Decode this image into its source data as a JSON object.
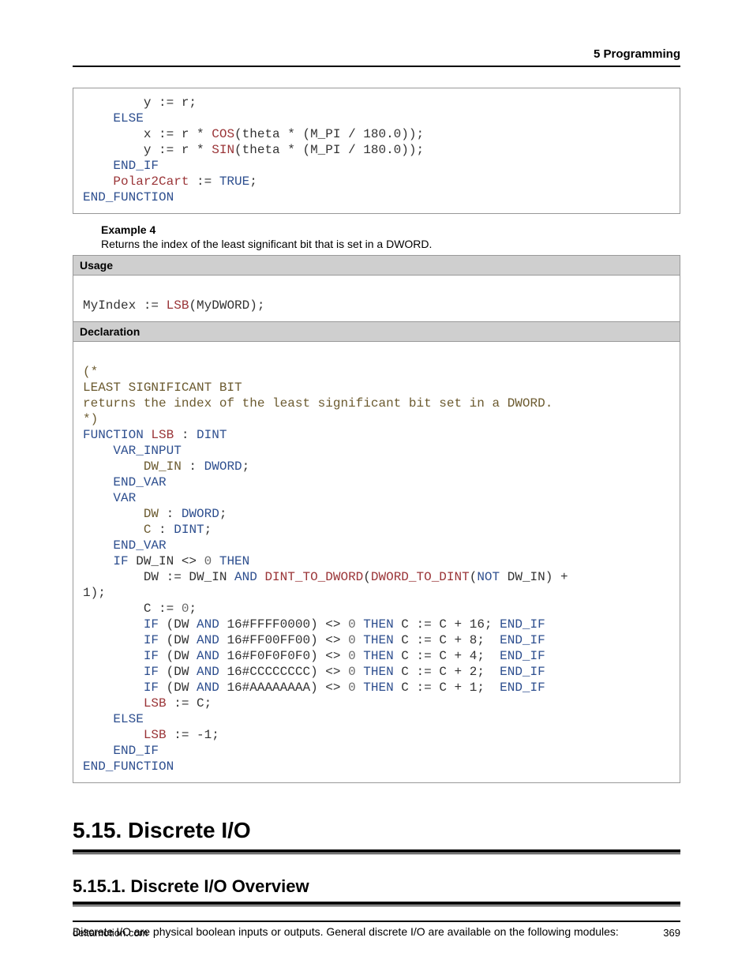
{
  "runhead": "5  Programming",
  "code1": {
    "l1a": "        y := r;",
    "l2a": "    ",
    "l2b": "ELSE",
    "l3a": "        x := r * ",
    "l3b": "COS",
    "l3c": "(theta * (M_PI / 180.0));",
    "l4a": "        y := r * ",
    "l4b": "SIN",
    "l4c": "(theta * (M_PI / 180.0));",
    "l5a": "    ",
    "l5b": "END_IF",
    "l6a": "    ",
    "l6b": "Polar2Cart",
    "l6c": " := ",
    "l6d": "TRUE",
    "l6e": ";",
    "l7": "END_FUNCTION"
  },
  "ex4": {
    "title": "Example 4",
    "desc": "Returns the index of the least significant bit that is set in a DWORD."
  },
  "usage_label": "Usage",
  "usage": {
    "a": "MyIndex := ",
    "b": "LSB",
    "c": "(MyDWORD);"
  },
  "decl_label": "Declaration",
  "code2": {
    "c1": "(*",
    "c2": "LEAST SIGNIFICANT BIT",
    "c3": "returns the index of the least significant bit set in a DWORD.",
    "c4": "*)",
    "f1a": "FUNCTION ",
    "f1b": "LSB",
    "f1c": " : ",
    "f1d": "DINT",
    "vi": "    VAR_INPUT",
    "via": "        ",
    "vib": "DW_IN",
    "vic": " : ",
    "vid": "DWORD",
    "vie": ";",
    "ev1": "    END_VAR",
    "vr": "    VAR",
    "vra": "        ",
    "vrb": "DW",
    "vrc": " : ",
    "vrd": "DWORD",
    "vre": ";",
    "vrca": "        ",
    "vrcb": "C",
    "vrcc": " : ",
    "vrcd": "DINT",
    "vrce": ";",
    "ev2": "    END_VAR",
    "ifa": "    ",
    "ifb": "IF",
    "ifc": " DW_IN <> ",
    "ifd": "0",
    "ife": " THEN",
    "da": "        DW := DW_IN ",
    "db": "AND",
    "dc": " ",
    "dd": "DINT_TO_DWORD",
    "de": "(",
    "df": "DWORD_TO_DINT",
    "dg": "(",
    "dh": "NOT",
    "di": " DW_IN) + ",
    "dj": "1);",
    "ca": "        C := ",
    "cb": "0",
    "cc": ";",
    "r1a": "        ",
    "r1b": "IF",
    "r1c": " (DW ",
    "r1d": "AND",
    "r1e": " 16#FFFF0000) <> ",
    "r1f": "0",
    "r1g": " THEN",
    "r1h": " C := C + 16; ",
    "r1i": "END_IF",
    "r2a": "        ",
    "r2b": "IF",
    "r2c": " (DW ",
    "r2d": "AND",
    "r2e": " 16#FF00FF00) <> ",
    "r2f": "0",
    "r2g": " THEN",
    "r2h": " C := C + 8;  ",
    "r2i": "END_IF",
    "r3a": "        ",
    "r3b": "IF",
    "r3c": " (DW ",
    "r3d": "AND",
    "r3e": " 16#F0F0F0F0) <> ",
    "r3f": "0",
    "r3g": " THEN",
    "r3h": " C := C + 4;  ",
    "r3i": "END_IF",
    "r4a": "        ",
    "r4b": "IF",
    "r4c": " (DW ",
    "r4d": "AND",
    "r4e": " 16#CCCCCCCC) <> ",
    "r4f": "0",
    "r4g": " THEN",
    "r4h": " C := C + 2;  ",
    "r4i": "END_IF",
    "r5a": "        ",
    "r5b": "IF",
    "r5c": " (DW ",
    "r5d": "AND",
    "r5e": " 16#AAAAAAAA) <> ",
    "r5f": "0",
    "r5g": " THEN",
    "r5h": " C := C + 1;  ",
    "r5i": "END_IF",
    "la": "        ",
    "lb": "LSB",
    "lc": " := C;",
    "el": "    ",
    "elb": "ELSE",
    "l2a": "        ",
    "l2b": "LSB",
    "l2c": " := -1;",
    "ei": "    ",
    "eib": "END_IF",
    "ef": "END_FUNCTION"
  },
  "h1": "5.15. Discrete I/O",
  "h2": "5.15.1. Discrete I/O Overview",
  "para": "Discrete I/O are physical boolean inputs or outputs. General discrete I/O are available on the following modules:",
  "footer_left": "deltamotion.com",
  "footer_right": "369"
}
